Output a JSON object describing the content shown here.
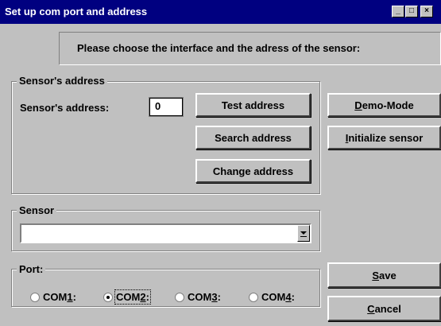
{
  "window": {
    "title": "Set up com port and address"
  },
  "header": {
    "instruction": "Please choose the interface and the adress of the sensor:"
  },
  "address_group": {
    "label": "Sensor's address",
    "field_label": "Sensor's address:",
    "address_value": "0",
    "buttons": {
      "test": "Test address",
      "search": "Search address",
      "change": "Change address"
    }
  },
  "side_buttons": {
    "demo_prefix": "D",
    "demo_rest": "emo-Mode",
    "init_prefix": "I",
    "init_rest": "nitialize sensor"
  },
  "sensor_group": {
    "label": "Sensor",
    "selected": ""
  },
  "port_group": {
    "label": "Port:",
    "options": [
      {
        "pre": "COM",
        "key": "1",
        "post": ":",
        "selected": false
      },
      {
        "pre": "COM",
        "key": "2",
        "post": ":",
        "selected": true
      },
      {
        "pre": "COM",
        "key": "3",
        "post": ":",
        "selected": false
      },
      {
        "pre": "COM",
        "key": "4",
        "post": ":",
        "selected": false
      }
    ]
  },
  "actions": {
    "save_prefix": "S",
    "save_rest": "ave",
    "cancel_prefix": "C",
    "cancel_rest": "ancel"
  },
  "icons": {
    "minimize": "minimize-icon",
    "maximize": "maximize-icon",
    "close": "close-icon",
    "dropdown": "chevron-down-icon"
  }
}
